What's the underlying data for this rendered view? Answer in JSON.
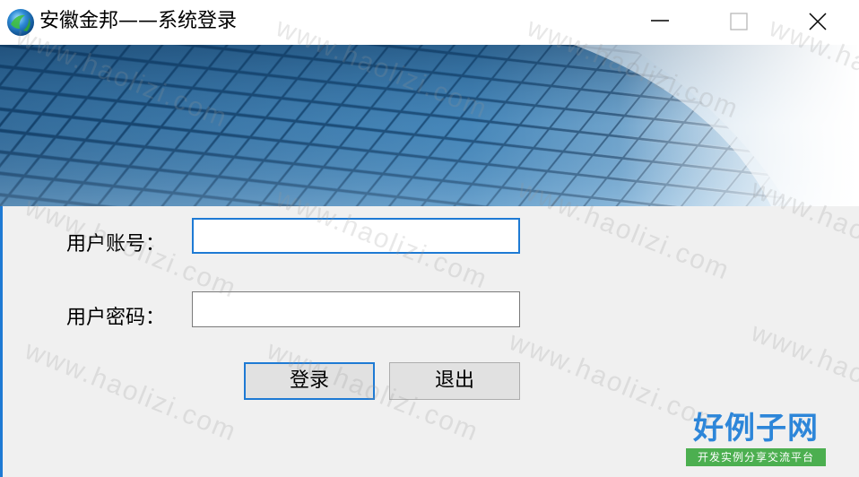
{
  "window": {
    "title": "安徽金邦——系统登录",
    "minimize": "minimize",
    "maximize": "maximize",
    "close": "close"
  },
  "banner": {
    "image": "glass building facade"
  },
  "form": {
    "username_label": "用户账号：",
    "username_value": "",
    "password_label": "用户密码：",
    "password_value": "",
    "login_button": "登录",
    "exit_button": "退出"
  },
  "watermark": {
    "text": "www.haolizi.com",
    "logo_main": "好例子网",
    "logo_sub": "开发实例分享交流平台"
  },
  "colors": {
    "accent": "#1e7ad4",
    "background": "#f0f0f0",
    "logo_blue": "#2d86d9",
    "logo_green": "#4caf50"
  }
}
